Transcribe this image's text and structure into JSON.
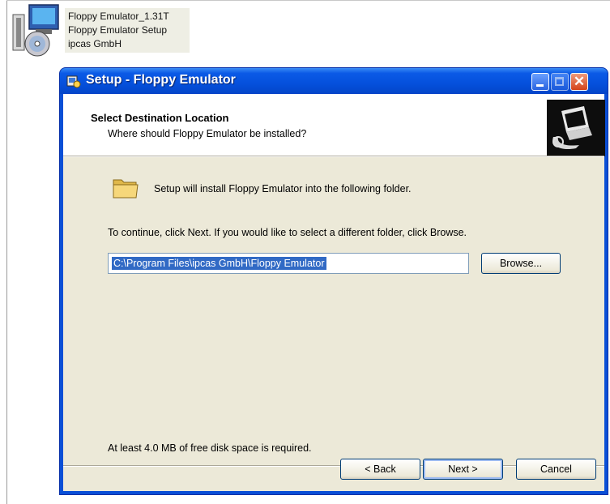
{
  "desktop_file": {
    "lines": [
      "Floppy Emulator_1.31T",
      "Floppy Emulator Setup",
      "ipcas GmbH"
    ],
    "icon": "installer-disc-icon"
  },
  "window": {
    "title": "Setup - Floppy Emulator",
    "title_icon": "setup-app-icon",
    "controls": {
      "minimize": "minimize-icon",
      "maximize": "maximize-icon",
      "close": "close-icon"
    }
  },
  "header": {
    "title": "Select Destination Location",
    "subtitle": "Where should Floppy Emulator be installed?",
    "logo": "computer-install-icon"
  },
  "body": {
    "intro": "Setup will install Floppy Emulator into the following folder.",
    "continue_text": "To continue, click Next. If you would like to select a different folder, click Browse.",
    "path_value": "C:\\Program Files\\ipcas GmbH\\Floppy Emulator",
    "browse_label": "Browse...",
    "disk_space": "At least 4.0 MB of free disk space is required."
  },
  "buttons": {
    "back": "< Back",
    "next": "Next >",
    "cancel": "Cancel"
  },
  "colors": {
    "titlebar": "#0550dc",
    "dialog_bg": "#ece9d8",
    "selection": "#316ac5"
  }
}
